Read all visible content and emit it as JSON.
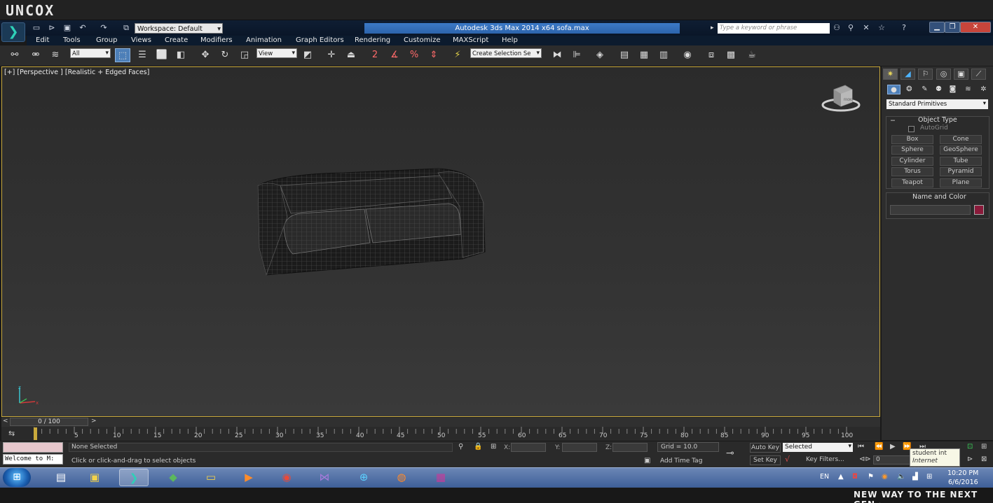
{
  "brand": {
    "logo": "UNCOX",
    "tagline": "NEW WAY TO THE NEXT GEN ›"
  },
  "title_bar": {
    "workspace": "Workspace: Default",
    "window_title": "Autodesk 3ds Max  2014 x64      sofa.max",
    "search_placeholder": "Type a keyword or phrase"
  },
  "menu": [
    "Edit",
    "Tools",
    "Group",
    "Views",
    "Create",
    "Modifiers",
    "Animation",
    "Graph Editors",
    "Rendering",
    "Customize",
    "MAXScript",
    "Help"
  ],
  "toolbar": {
    "filter_value": "All",
    "ref_coord_value": "View",
    "selection_set_placeholder": "Create Selection Se"
  },
  "viewport": {
    "label": "[+] [Perspective ] [Realistic + Edged Faces]",
    "cube_label": "FRONT"
  },
  "command_panel": {
    "category": "Standard Primitives",
    "object_type_title": "Object Type",
    "autogrid_label": "AutoGrid",
    "primitives": [
      "Box",
      "Cone",
      "Sphere",
      "GeoSphere",
      "Cylinder",
      "Tube",
      "Torus",
      "Pyramid",
      "Teapot",
      "Plane"
    ],
    "name_color_title": "Name and Color",
    "swatch_color": "#8a1a3a"
  },
  "timeline": {
    "slider_label": "0 / 100",
    "ticks": [
      "5",
      "10",
      "15",
      "20",
      "25",
      "30",
      "35",
      "40",
      "45",
      "50",
      "55",
      "60",
      "65",
      "70",
      "75",
      "80",
      "85",
      "90",
      "95",
      "100"
    ]
  },
  "status": {
    "listener_text": "Welcome to M:",
    "selection": "None Selected",
    "prompt": "Click or click-and-drag to select objects",
    "x_label": "X:",
    "y_label": "Y:",
    "z_label": "Z:",
    "grid": "Grid = 10.0",
    "add_time_tag": "Add Time Tag",
    "auto_key": "Auto Key",
    "set_key": "Set Key",
    "selected_value": "Selected",
    "key_filters": "Key Filters...",
    "frame_value": "0",
    "tooltip_line1": "student int",
    "tooltip_line2": "Internet access"
  },
  "taskbar": {
    "lang": "EN",
    "time": "10:20 PM",
    "date": "6/6/2016"
  }
}
